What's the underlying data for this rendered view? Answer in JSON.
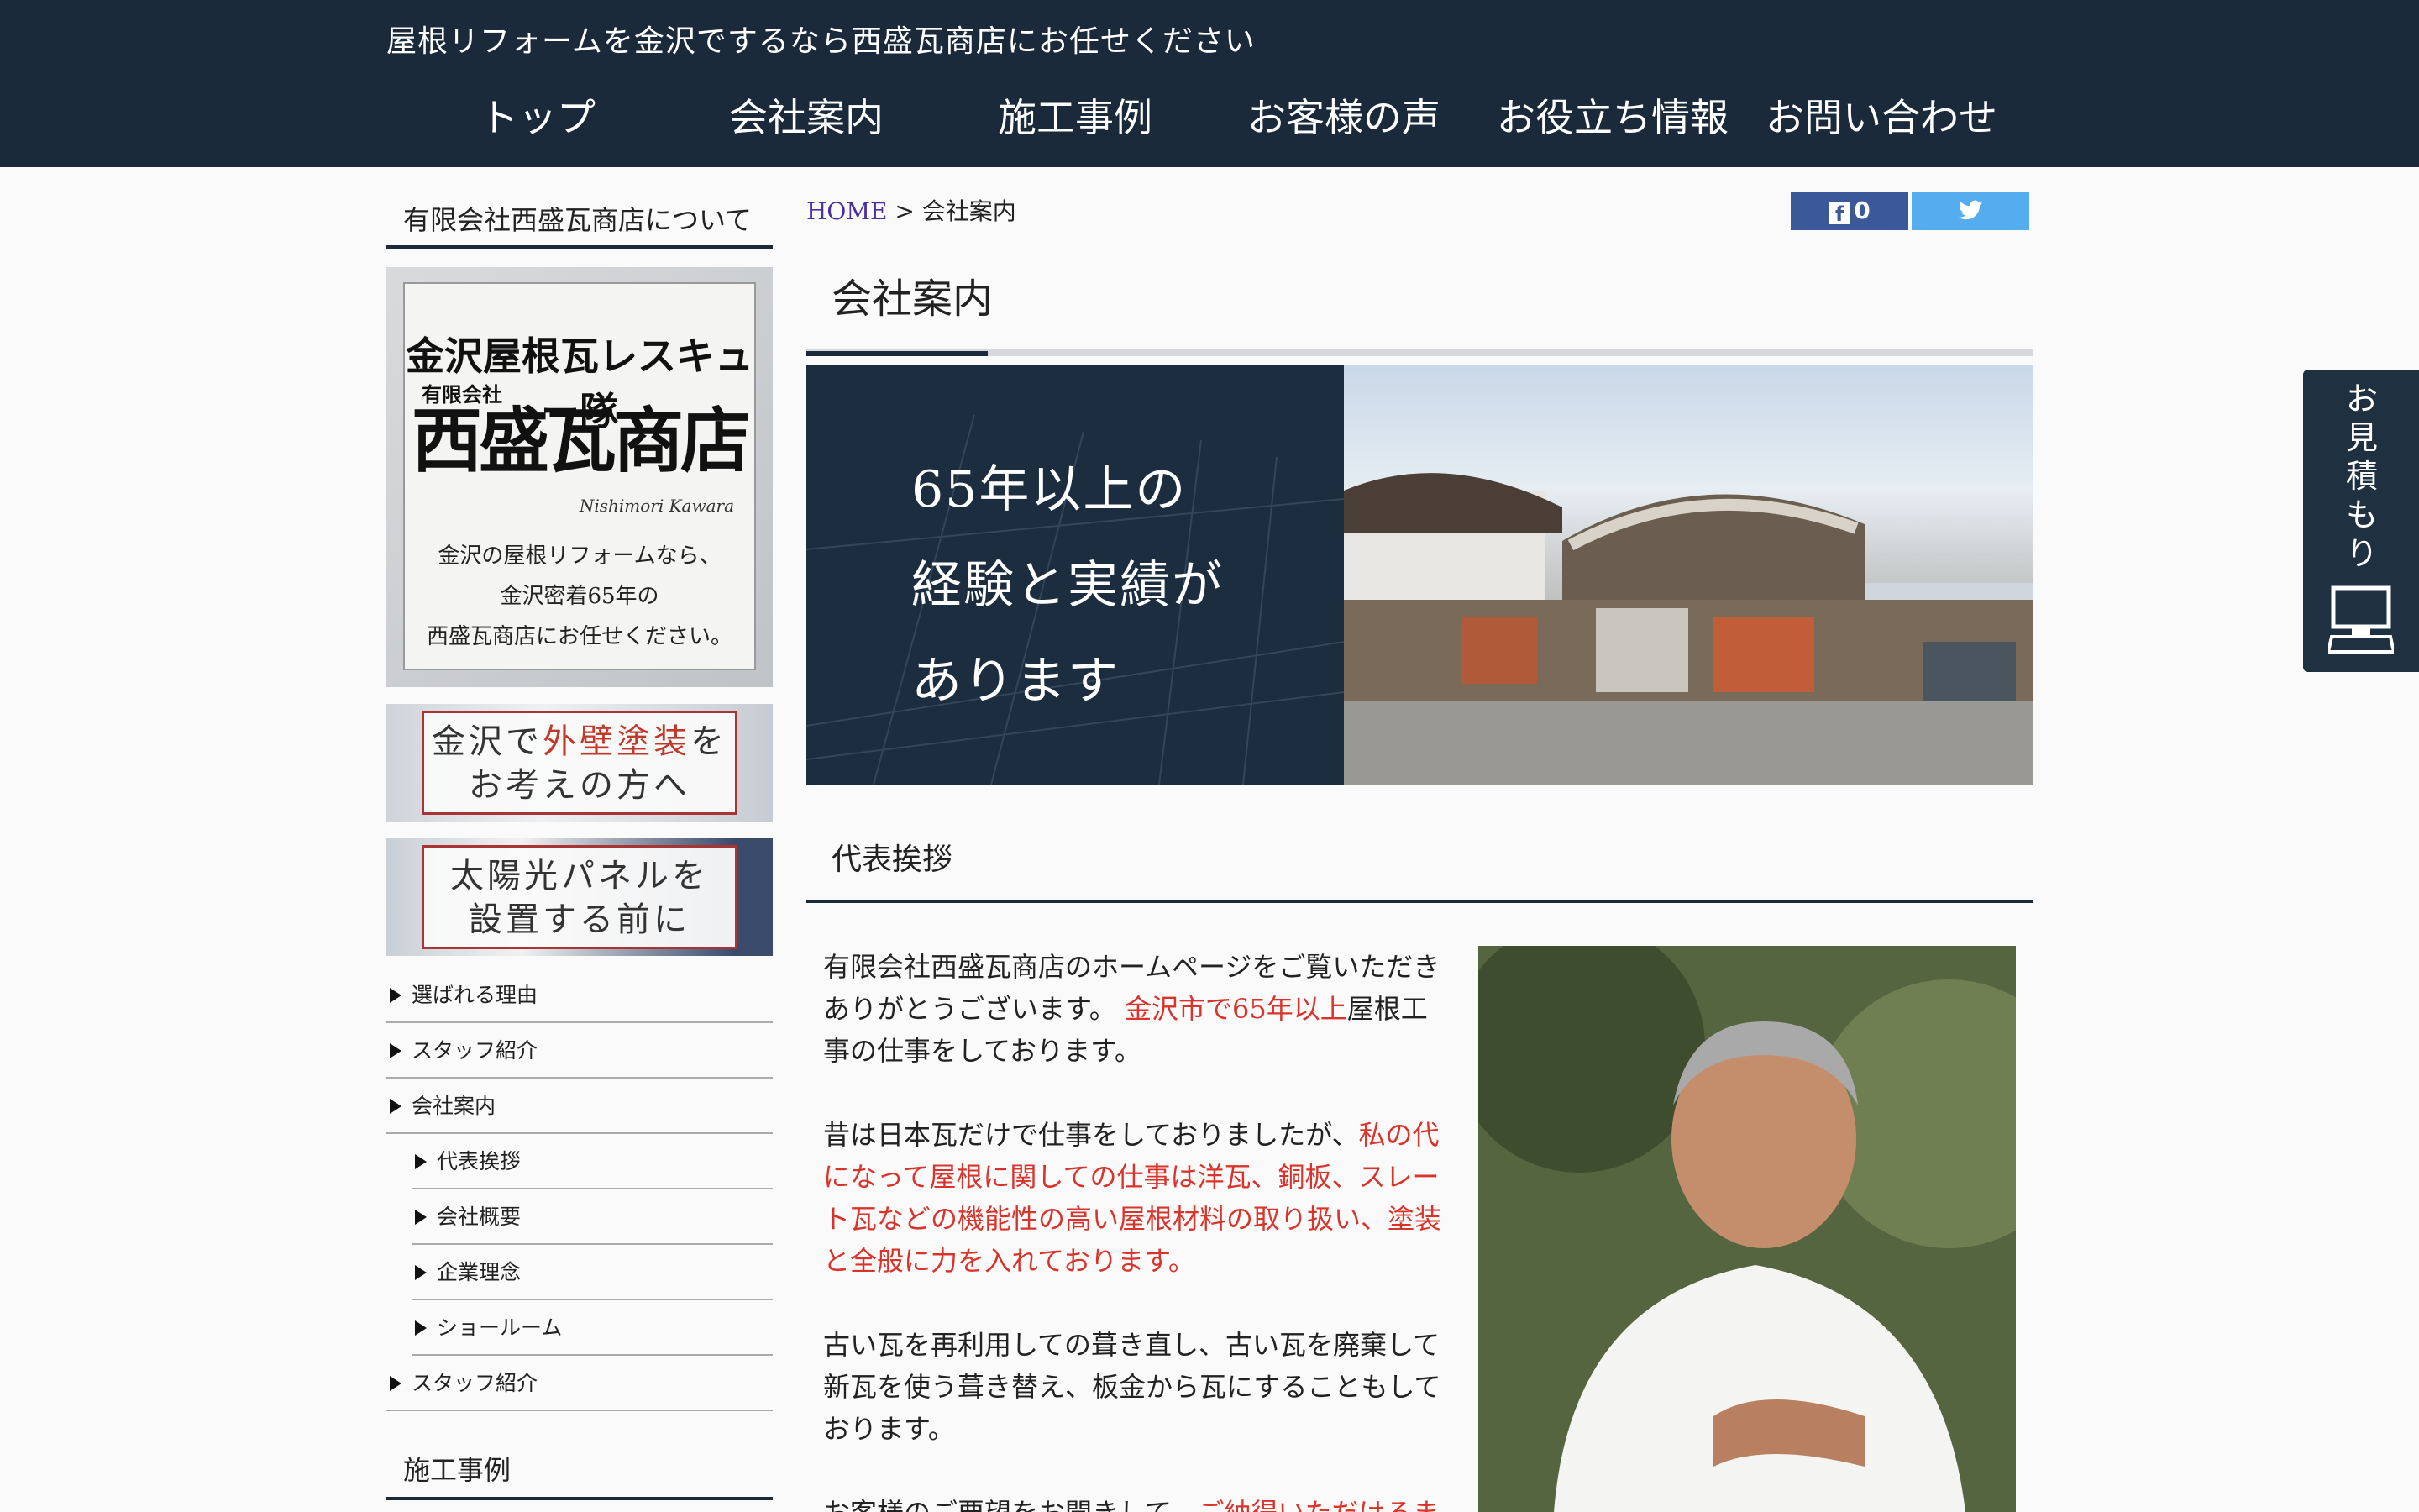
{
  "header": {
    "tagline": "屋根リフォームを金沢でするなら西盛瓦商店にお任せください",
    "nav": [
      "トップ",
      "会社案内",
      "施工事例",
      "お客様の声",
      "お役立ち情報",
      "お問い合わせ"
    ]
  },
  "sidebar": {
    "about_heading": "有限会社西盛瓦商店について",
    "banner_main": {
      "line1": "金沢屋根瓦レスキュー隊",
      "company_type": "有限会社",
      "name": "西盛瓦商店",
      "signature": "Nishimori Kawara",
      "desc": [
        "金沢の屋根リフォームなら、",
        "金沢密着65年の",
        "西盛瓦商店にお任せください。"
      ]
    },
    "banner_paint": {
      "line1_a": "金沢で",
      "line1_b": "外壁塗装",
      "line1_c": "を",
      "line2": "お考えの方へ"
    },
    "banner_solar": {
      "line1": "太陽光パネルを",
      "line2": "設置する前に"
    },
    "menu": [
      {
        "label": "選ばれる理由"
      },
      {
        "label": "スタッフ紹介"
      },
      {
        "label": "会社案内"
      },
      {
        "label": "代表挨拶"
      },
      {
        "label": "会社概要"
      },
      {
        "label": "企業理念"
      },
      {
        "label": "ショールーム"
      },
      {
        "label": "スタッフ紹介"
      }
    ],
    "works_heading": "施工事例"
  },
  "breadcrumb": {
    "home": "HOME",
    "sep": ">",
    "current": "会社案内"
  },
  "share": {
    "fb_count": "0"
  },
  "page_title": "会社案内",
  "hero": {
    "lines": [
      "65年以上の",
      "経験と実績が",
      "あります"
    ]
  },
  "section_title": "代表挨拶",
  "body": {
    "p1_a": "有限会社西盛瓦商店のホームページをご覧いただきありがとうございます。",
    "p1_b": "金沢市で65年以上",
    "p1_c": "屋根工事の仕事をしております。",
    "p2_a": "昔は日本瓦だけで仕事をしておりましたが、",
    "p2_b": "私の代になって屋根に関しての仕事は洋瓦、銅板、スレート瓦などの機能性の高い屋根材料の取り扱い、塗装と全般に力を入れております。",
    "p3": "古い瓦を再利用しての葺き直し、古い瓦を廃棄して新瓦を使う葺き替え、板金から瓦にすることもしております。",
    "p4_a": "お客様のご要望をお聞きして、",
    "p4_b": "ご納得いただけるま"
  },
  "estimate_tab": {
    "label": "お見積もり"
  },
  "colors": {
    "navy": "#1a2a3a",
    "accent_red": "#d9342b",
    "facebook": "#3b5998",
    "twitter": "#55acee"
  }
}
